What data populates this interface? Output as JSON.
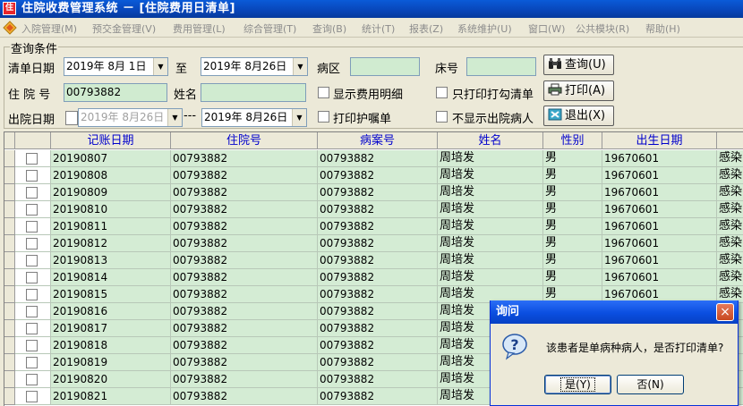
{
  "window": {
    "title": "住院收费管理系统 － [住院费用日清单]",
    "icon_text": "住"
  },
  "menu": [
    "入院管理(M)",
    "预交金管理(V)",
    "费用管理(L)",
    "综合管理(T)",
    "查询(B)",
    "统计(T)",
    "报表(Z)",
    "系统维护(U)",
    "窗口(W)",
    "公共模块(R)",
    "帮助(H)"
  ],
  "query": {
    "group_title": "查询条件",
    "bill_date_label": "清单日期",
    "date_from": "2019年  8月  1日",
    "to_label": "至",
    "date_to": "2019年  8月26日",
    "ward_label": "病区",
    "ward_value": "",
    "bed_label": "床号",
    "bed_value": "",
    "admission_no_label": "住 院 号",
    "admission_no_value": "00793882",
    "name_label": "姓名",
    "name_value": "",
    "show_detail_label": "显示费用明细",
    "print_checked_only_label": "只打印打勾清单",
    "discharge_date_label": "出院日期",
    "discharge_from": "2019年  8月26日",
    "range_sep": "---",
    "discharge_to": "2019年  8月26日",
    "print_nursing_label": "打印护嘱单",
    "hide_discharged_label": "不显示出院病人",
    "query_button": "查询(U)",
    "print_button": "打印(A)",
    "exit_button": "退出(X)"
  },
  "table": {
    "columns": [
      "记账日期",
      "住院号",
      "病案号",
      "姓名",
      "性别",
      "出生日期",
      ""
    ],
    "rows": [
      {
        "date": "20190807",
        "admission_no": "00793882",
        "record_no": "00793882",
        "name": "周培发",
        "gender": "男",
        "birth": "19670601",
        "extra": "感染"
      },
      {
        "date": "20190808",
        "admission_no": "00793882",
        "record_no": "00793882",
        "name": "周培发",
        "gender": "男",
        "birth": "19670601",
        "extra": "感染"
      },
      {
        "date": "20190809",
        "admission_no": "00793882",
        "record_no": "00793882",
        "name": "周培发",
        "gender": "男",
        "birth": "19670601",
        "extra": "感染"
      },
      {
        "date": "20190810",
        "admission_no": "00793882",
        "record_no": "00793882",
        "name": "周培发",
        "gender": "男",
        "birth": "19670601",
        "extra": "感染"
      },
      {
        "date": "20190811",
        "admission_no": "00793882",
        "record_no": "00793882",
        "name": "周培发",
        "gender": "男",
        "birth": "19670601",
        "extra": "感染"
      },
      {
        "date": "20190812",
        "admission_no": "00793882",
        "record_no": "00793882",
        "name": "周培发",
        "gender": "男",
        "birth": "19670601",
        "extra": "感染"
      },
      {
        "date": "20190813",
        "admission_no": "00793882",
        "record_no": "00793882",
        "name": "周培发",
        "gender": "男",
        "birth": "19670601",
        "extra": "感染"
      },
      {
        "date": "20190814",
        "admission_no": "00793882",
        "record_no": "00793882",
        "name": "周培发",
        "gender": "男",
        "birth": "19670601",
        "extra": "感染"
      },
      {
        "date": "20190815",
        "admission_no": "00793882",
        "record_no": "00793882",
        "name": "周培发",
        "gender": "男",
        "birth": "19670601",
        "extra": "感染"
      },
      {
        "date": "20190816",
        "admission_no": "00793882",
        "record_no": "00793882",
        "name": "周培发",
        "gender": "",
        "birth": "",
        "extra": ""
      },
      {
        "date": "20190817",
        "admission_no": "00793882",
        "record_no": "00793882",
        "name": "周培发",
        "gender": "",
        "birth": "",
        "extra": ""
      },
      {
        "date": "20190818",
        "admission_no": "00793882",
        "record_no": "00793882",
        "name": "周培发",
        "gender": "",
        "birth": "",
        "extra": ""
      },
      {
        "date": "20190819",
        "admission_no": "00793882",
        "record_no": "00793882",
        "name": "周培发",
        "gender": "",
        "birth": "",
        "extra": ""
      },
      {
        "date": "20190820",
        "admission_no": "00793882",
        "record_no": "00793882",
        "name": "周培发",
        "gender": "",
        "birth": "",
        "extra": ""
      },
      {
        "date": "20190821",
        "admission_no": "00793882",
        "record_no": "00793882",
        "name": "周培发",
        "gender": "",
        "birth": "",
        "extra": ""
      }
    ]
  },
  "dialog": {
    "title": "询问",
    "message": "该患者是单病种病人，是否打印清单?",
    "yes_button": "是(Y)",
    "no_button": "否(N)",
    "close_symbol": "×",
    "icon": "question-icon"
  },
  "colors": {
    "title_blue": "#0a5bd8",
    "cell_green": "#d4ecd4",
    "header_text": "#0000cc",
    "field_green": "#d0ebd0"
  }
}
